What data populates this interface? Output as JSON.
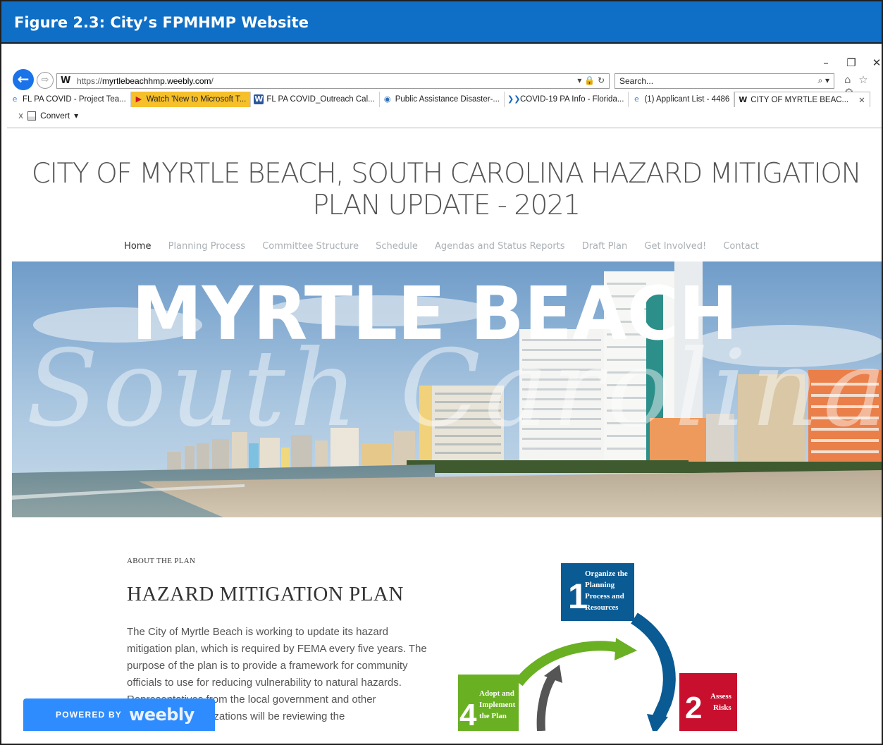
{
  "figure": {
    "caption": "Figure 2.3: City’s FPMHMP Website"
  },
  "browser": {
    "window_controls": {
      "minimize": "–",
      "restore": "❐",
      "close": "✕"
    },
    "address": {
      "prefix": "https://",
      "domain": "myrtlebeachhmp.weebly.com",
      "suffix": "/",
      "icons": "▾ 🔒 ↻"
    },
    "search": {
      "placeholder": "Search...",
      "icon": "⌕ ▾"
    },
    "toolbar_icons": "⌂ ☆ ⚙",
    "tabs": [
      {
        "label": "FL PA COVID - Project Tea...",
        "icon": "ie-icon",
        "glyph": "e"
      },
      {
        "label": "Watch 'New to Microsoft T...",
        "icon": "play-icon",
        "glyph": "▶"
      },
      {
        "label": "FL PA COVID_Outreach Cal...",
        "icon": "word-icon",
        "glyph": "W"
      },
      {
        "label": "Public Assistance Disaster-...",
        "icon": "gov-seal-icon",
        "glyph": "◉"
      },
      {
        "label": "COVID-19 PA Info - Florida...",
        "icon": "arrow-icon",
        "glyph": "❯❯"
      },
      {
        "label": "(1) Applicant List - 4486",
        "icon": "ie-icon",
        "glyph": "e"
      },
      {
        "label": "CITY OF MYRTLE BEAC...",
        "icon": "weebly-icon",
        "glyph": "W"
      }
    ],
    "command_bar": {
      "close": "x",
      "convert": "Convert",
      "dropdown": "▾"
    }
  },
  "site": {
    "title": "CITY OF MYRTLE BEACH, SOUTH CAROLINA HAZARD MITIGATION PLAN UPDATE - 2021",
    "nav": [
      "Home",
      "Planning Process",
      "Committee Structure",
      "Schedule",
      "Agendas and Status Reports",
      "Draft Plan",
      "Get Involved!",
      "Contact"
    ],
    "hero": {
      "headline": "MYRTLE BEACH",
      "script": "South Carolina"
    },
    "about": {
      "label": "ABOUT THE PLAN",
      "title": "HAZARD MITIGATION PLAN",
      "body": "The City of Myrtle Beach is working to update its hazard mitigation plan, which is required by FEMA every five years. The purpose of the plan is to provide a framework for community officials to use for reducing vulnerability to natural hazards. Representatives from the local government and other stakeholder organizations will be reviewing the"
    },
    "cycle_diagram": {
      "steps": [
        {
          "number": "1",
          "text": [
            "Organize the",
            "Planning",
            "Process and",
            "Resources"
          ],
          "color": "#0a5a93"
        },
        {
          "number": "2",
          "text": [
            "Assess",
            "Risks"
          ],
          "color": "#c8102e"
        },
        {
          "number": "4",
          "text": [
            "Adopt and",
            "Implement",
            "the Plan"
          ],
          "color": "#6ab023"
        }
      ]
    },
    "badge": {
      "powered_by": "POWERED BY",
      "brand": "weebly",
      "color": "#2e8cff"
    }
  }
}
